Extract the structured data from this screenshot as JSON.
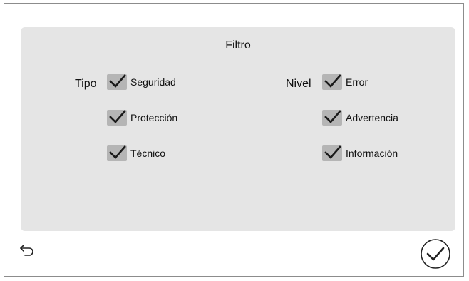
{
  "filter": {
    "title": "Filtro",
    "tipo": {
      "label": "Tipo",
      "options": [
        {
          "label": "Seguridad",
          "checked": true
        },
        {
          "label": "Protección",
          "checked": true
        },
        {
          "label": "Técnico",
          "checked": true
        }
      ]
    },
    "nivel": {
      "label": "Nivel",
      "options": [
        {
          "label": "Error",
          "checked": true
        },
        {
          "label": "Advertencia",
          "checked": true
        },
        {
          "label": "Información",
          "checked": true
        }
      ]
    }
  },
  "footer": {
    "back_icon": "back-arrow-icon",
    "confirm_icon": "check-circle-icon"
  },
  "colors": {
    "panel_bg": "#e5e5e5",
    "checkbox_bg": "#b5b5b5",
    "check_mark": "#1a1a1a",
    "border": "#8c8c8c"
  }
}
